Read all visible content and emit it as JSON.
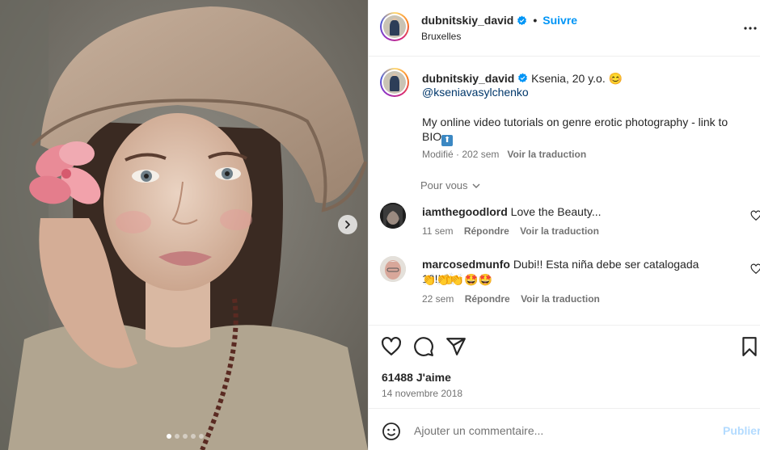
{
  "post": {
    "username": "dubnitskiy_david",
    "follow_label": "Suivre",
    "separator": "•",
    "location": "Bruxelles"
  },
  "caption": {
    "username": "dubnitskiy_david",
    "first_line": "Ksenia, 20 y.o. 😊",
    "mention": "@kseniavasylchenko",
    "text": "My online video tutorials on genre erotic photography - link to BIO",
    "arrow_emoji": "⬆",
    "modified": "Modifié · 202 sem",
    "translate": "Voir la traduction"
  },
  "comments_header": "Pour vous",
  "comments": [
    {
      "username": "iamthegoodlord",
      "text": "Love the Beauty...",
      "emoji_line": "",
      "age": "11 sem",
      "reply": "Répondre",
      "translate": "Voir la traduction"
    },
    {
      "username": "marcosedmunfo",
      "text": "Dubi!! Esta niña debe ser catalogada 10!!👏",
      "emoji_line": "👏👏👏🤩🤩",
      "age": "22 sem",
      "reply": "Répondre",
      "translate": "Voir la traduction"
    }
  ],
  "likes": {
    "count": "61488",
    "label": "J'aime"
  },
  "date": "14 novembre 2018",
  "comment_box": {
    "placeholder": "Ajouter un commentaire...",
    "publish": "Publier"
  },
  "carousel": {
    "active_index": 0,
    "total": 5
  },
  "colors": {
    "link_blue": "#0095f6",
    "mention_navy": "#00376b",
    "publish_disabled": "#b3dbff"
  },
  "icons": [
    "verified-badge-icon",
    "more-options-icon",
    "chevron-right-icon",
    "chevron-down-icon",
    "heart-icon",
    "comment-icon",
    "share-icon",
    "bookmark-icon",
    "emoji-icon"
  ]
}
